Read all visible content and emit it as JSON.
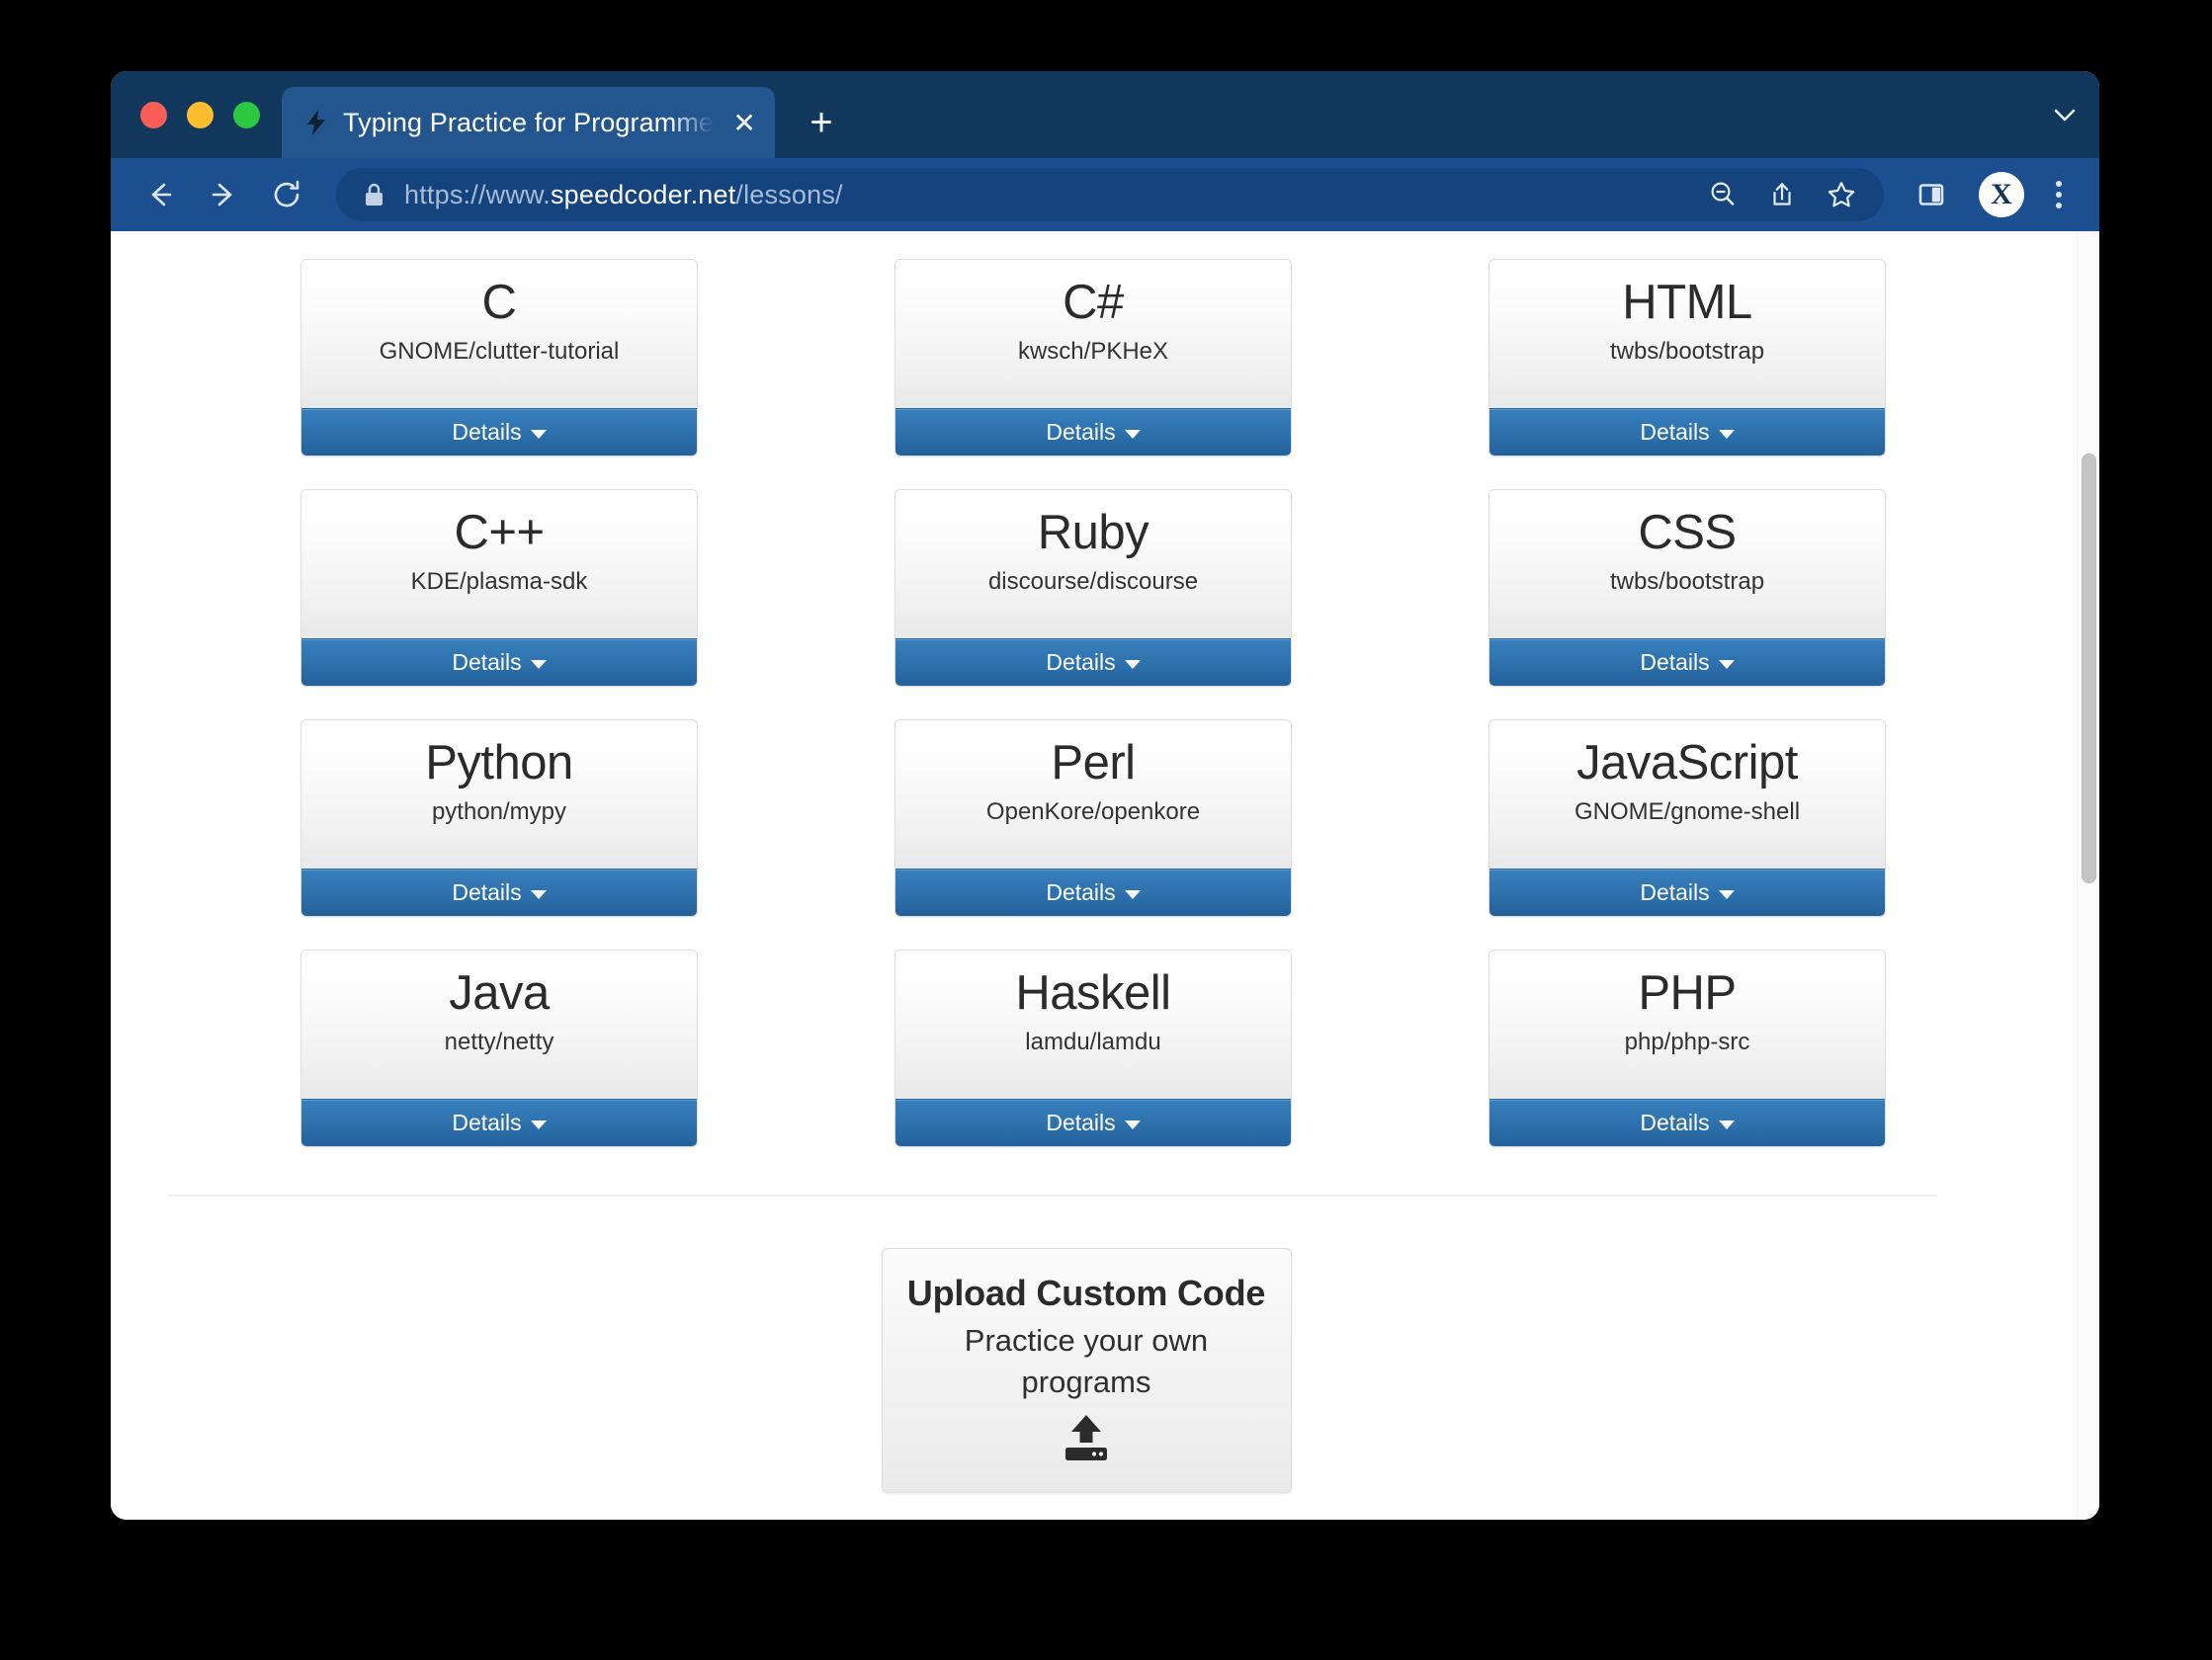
{
  "window": {
    "traffic_lights": [
      "close",
      "minimize",
      "maximize"
    ],
    "colors": {
      "tabstrip_bg": "#12375d",
      "active_tab_bg": "#23568f",
      "toolbar_bg": "#1b4f90",
      "details_button": "#2e72ae",
      "traffic_red": "#fa5e57",
      "traffic_yellow": "#fdbd2e",
      "traffic_green": "#2bc840"
    }
  },
  "tabs": {
    "active": {
      "favicon": "lightning-bolt-icon",
      "title": "Typing Practice for Programme",
      "close_label": "✕"
    },
    "new_tab_label": "+",
    "tabstrip_chevron": "chevron-down-icon"
  },
  "toolbar": {
    "back_icon": "arrow-left-icon",
    "forward_icon": "arrow-right-icon",
    "reload_icon": "reload-icon",
    "lock_icon": "lock-icon",
    "url_prefix": "https://www.",
    "url_domain": "speedcoder.net",
    "url_path": "/lessons/",
    "url_full": "https://www.speedcoder.net/lessons/",
    "url_placeholder": "Search or enter web address",
    "zoom_out_icon": "zoom-out-icon",
    "share_icon": "share-icon",
    "bookmark_icon": "star-icon",
    "sidebar_icon": "sidebar-panel-icon",
    "profile_initial": "X",
    "menu_icon": "three-dot-menu-icon"
  },
  "main": {
    "details_label": "Details",
    "details_caret": "caret-down-icon",
    "cards": [
      {
        "language": "C",
        "repo": "GNOME/clutter-tutorial"
      },
      {
        "language": "C#",
        "repo": "kwsch/PKHeX"
      },
      {
        "language": "HTML",
        "repo": "twbs/bootstrap"
      },
      {
        "language": "C++",
        "repo": "KDE/plasma-sdk"
      },
      {
        "language": "Ruby",
        "repo": "discourse/discourse"
      },
      {
        "language": "CSS",
        "repo": "twbs/bootstrap"
      },
      {
        "language": "Python",
        "repo": "python/mypy"
      },
      {
        "language": "Perl",
        "repo": "OpenKore/openkore"
      },
      {
        "language": "JavaScript",
        "repo": "GNOME/gnome-shell"
      },
      {
        "language": "Java",
        "repo": "netty/netty"
      },
      {
        "language": "Haskell",
        "repo": "lamdu/lamdu"
      },
      {
        "language": "PHP",
        "repo": "php/php-src"
      }
    ],
    "upload": {
      "title": "Upload Custom Code",
      "subtitle": "Practice your own programs",
      "icon": "hard-drive-upload-icon"
    }
  },
  "scrollbar": {
    "orientation": "vertical",
    "thumb_position_pct": 35
  }
}
